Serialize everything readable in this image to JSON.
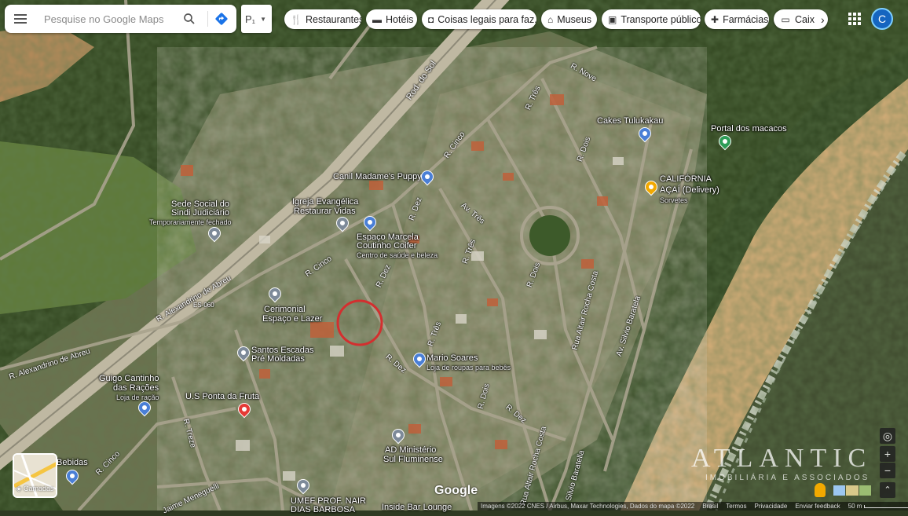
{
  "search": {
    "placeholder": "Pesquise no Google Maps"
  },
  "transit_box": {
    "label": "P₁"
  },
  "chips": [
    {
      "label": "Restaurantes",
      "icon": "fork-knife-icon"
    },
    {
      "label": "Hotéis",
      "icon": "bed-icon"
    },
    {
      "label": "Coisas legais para faz...",
      "icon": "camera-icon"
    },
    {
      "label": "Museus",
      "icon": "museum-icon"
    },
    {
      "label": "Transporte público",
      "icon": "train-icon"
    },
    {
      "label": "Farmácias",
      "icon": "pharmacy-icon"
    },
    {
      "label": "Caix",
      "icon": "atm-icon"
    }
  ],
  "avatar": {
    "initial": "C",
    "color": "#1565c0"
  },
  "layers": {
    "label": "Camadas"
  },
  "places": [
    {
      "name": "Canil Madame's Puppy",
      "sub": ""
    },
    {
      "name": "Sede Social do",
      "sub": ""
    },
    {
      "name": "Sindi Judiciário",
      "sub": "Temporariamente fechado"
    },
    {
      "name": "Igreja Evangélica",
      "sub": ""
    },
    {
      "name": "Restaurar Vidas",
      "sub": ""
    },
    {
      "name": "Espaço Marcela",
      "sub": ""
    },
    {
      "name": "Coutinho Coifer",
      "sub": "Centro de saúde e beleza"
    },
    {
      "name": "Cerimonial",
      "sub": ""
    },
    {
      "name": "Espaço e Lazer",
      "sub": ""
    },
    {
      "name": "Santos Escadas",
      "sub": ""
    },
    {
      "name": "Pré Moldadas",
      "sub": ""
    },
    {
      "name": "Mario Soares",
      "sub": "Loja de roupas para bebês"
    },
    {
      "name": "Guigo Cantinho",
      "sub": ""
    },
    {
      "name": "das Rações",
      "sub": "Loja de ração"
    },
    {
      "name": "U.S Ponta da Fruta",
      "sub": ""
    },
    {
      "name": "AD Ministério",
      "sub": ""
    },
    {
      "name": "Sul Fluminense",
      "sub": ""
    },
    {
      "name": "UMEF PROF. NAIR",
      "sub": ""
    },
    {
      "name": "DIAS BARBOSA",
      "sub": ""
    },
    {
      "name": "Inside Bar Lounge",
      "sub": ""
    },
    {
      "name": "Bebidas",
      "sub": ""
    },
    {
      "name": "Cakes Tulukakau",
      "sub": ""
    },
    {
      "name": "Portal dos macacos",
      "sub": ""
    },
    {
      "name": "CALIFÓRNIA",
      "sub": ""
    },
    {
      "name": "AÇAÍ (Delivery)",
      "sub": "Sorvetes"
    }
  ],
  "roads": [
    "Rod. do Sol",
    "R. Nove",
    "R. Três",
    "R. Cinco",
    "R. Dois",
    "R. Dez",
    "Av. Três",
    "R. Três",
    "R. Alexandrino de Abreu",
    "R. Alexandrino de Abreu",
    "ES-060",
    "R. Cinco",
    "R. Dez",
    "R. Três",
    "R. Dois",
    "R. Dez",
    "Rua Altair Rocha Costa",
    "Av. Silvio Baratela",
    "R. Treze",
    "R. Cinco",
    "Jaime Meneguelli",
    "Rua Altair Rocha Costa",
    "Silvio Baratella",
    "R. Dois",
    "R. Dez"
  ],
  "google_logo": "Google",
  "attribution": {
    "imagery": "Imagens ©2022 CNES / Airbus, Maxar Technologies, Dados do mapa ©2022",
    "country": "Brasil",
    "terms": "Termos",
    "privacy": "Privacidade",
    "feedback": "Enviar feedback",
    "scale": "50 m"
  },
  "watermark": {
    "brand": "ATLANTIC",
    "tagline": "IMOBILIÁRIA E ASSOCIADOS"
  },
  "colors": {
    "forest": "#2f4a22",
    "sand": "#d9b07a",
    "sea": "#3e4a2c",
    "highway": "#c8c0a8",
    "marker": "#d32f2f"
  }
}
